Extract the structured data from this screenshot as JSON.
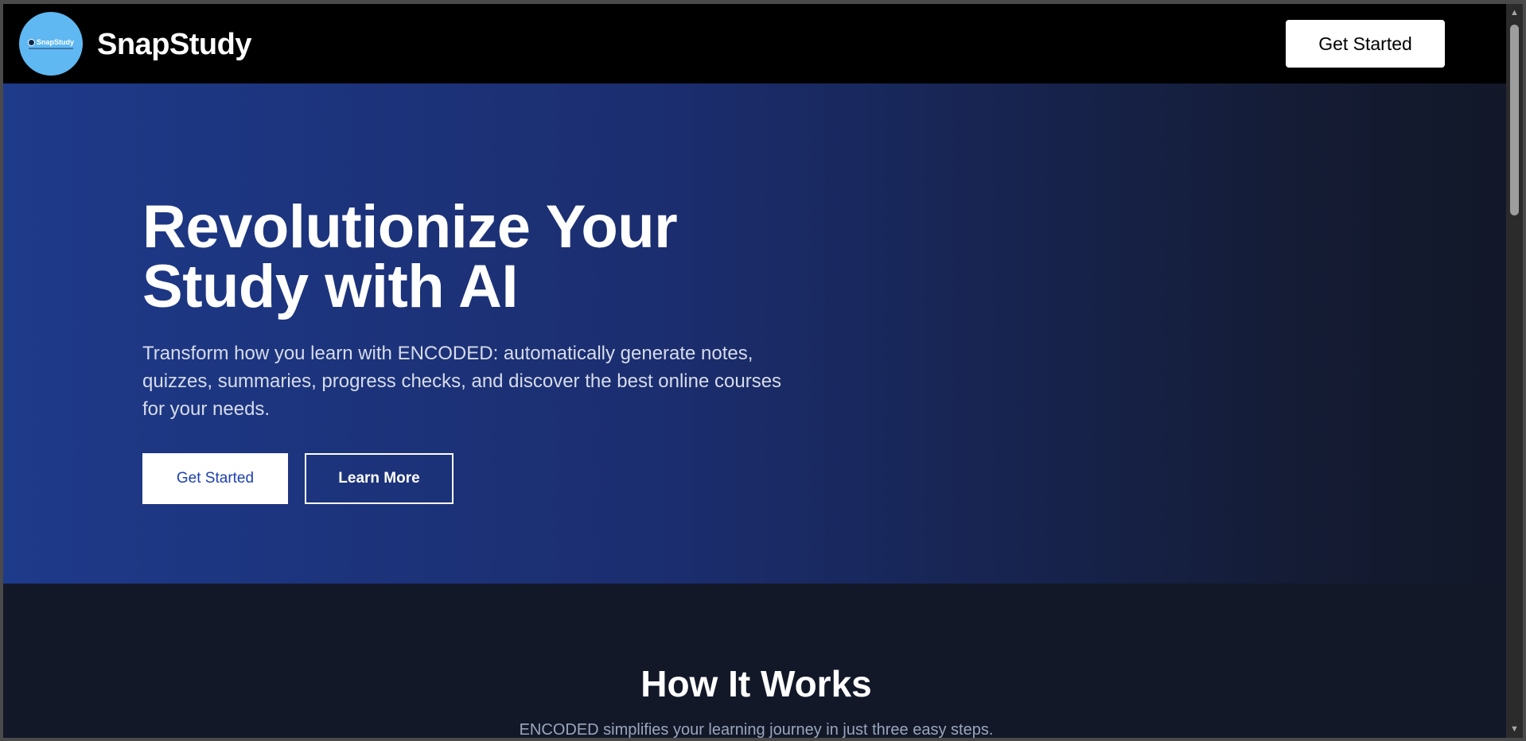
{
  "header": {
    "logo_text": "SnapStudy",
    "brand_name": "SnapStudy",
    "cta_label": "Get Started"
  },
  "hero": {
    "title": "Revolutionize Your Study with AI",
    "subtitle": "Transform how you learn with ENCODED: automatically generate notes, quizzes, summaries, progress checks, and discover the best online courses for your needs.",
    "primary_button": "Get Started",
    "secondary_button": "Learn More"
  },
  "how_it_works": {
    "title": "How It Works",
    "subtitle": "ENCODED simplifies your learning journey in just three easy steps."
  },
  "scrollbar": {
    "up_icon": "▲",
    "down_icon": "▼"
  },
  "colors": {
    "header_bg": "#000000",
    "hero_gradient_start": "#1e3a8a",
    "page_bg": "#121828",
    "logo_bg": "#5fb8f2",
    "primary_button_text": "#1e40af"
  }
}
